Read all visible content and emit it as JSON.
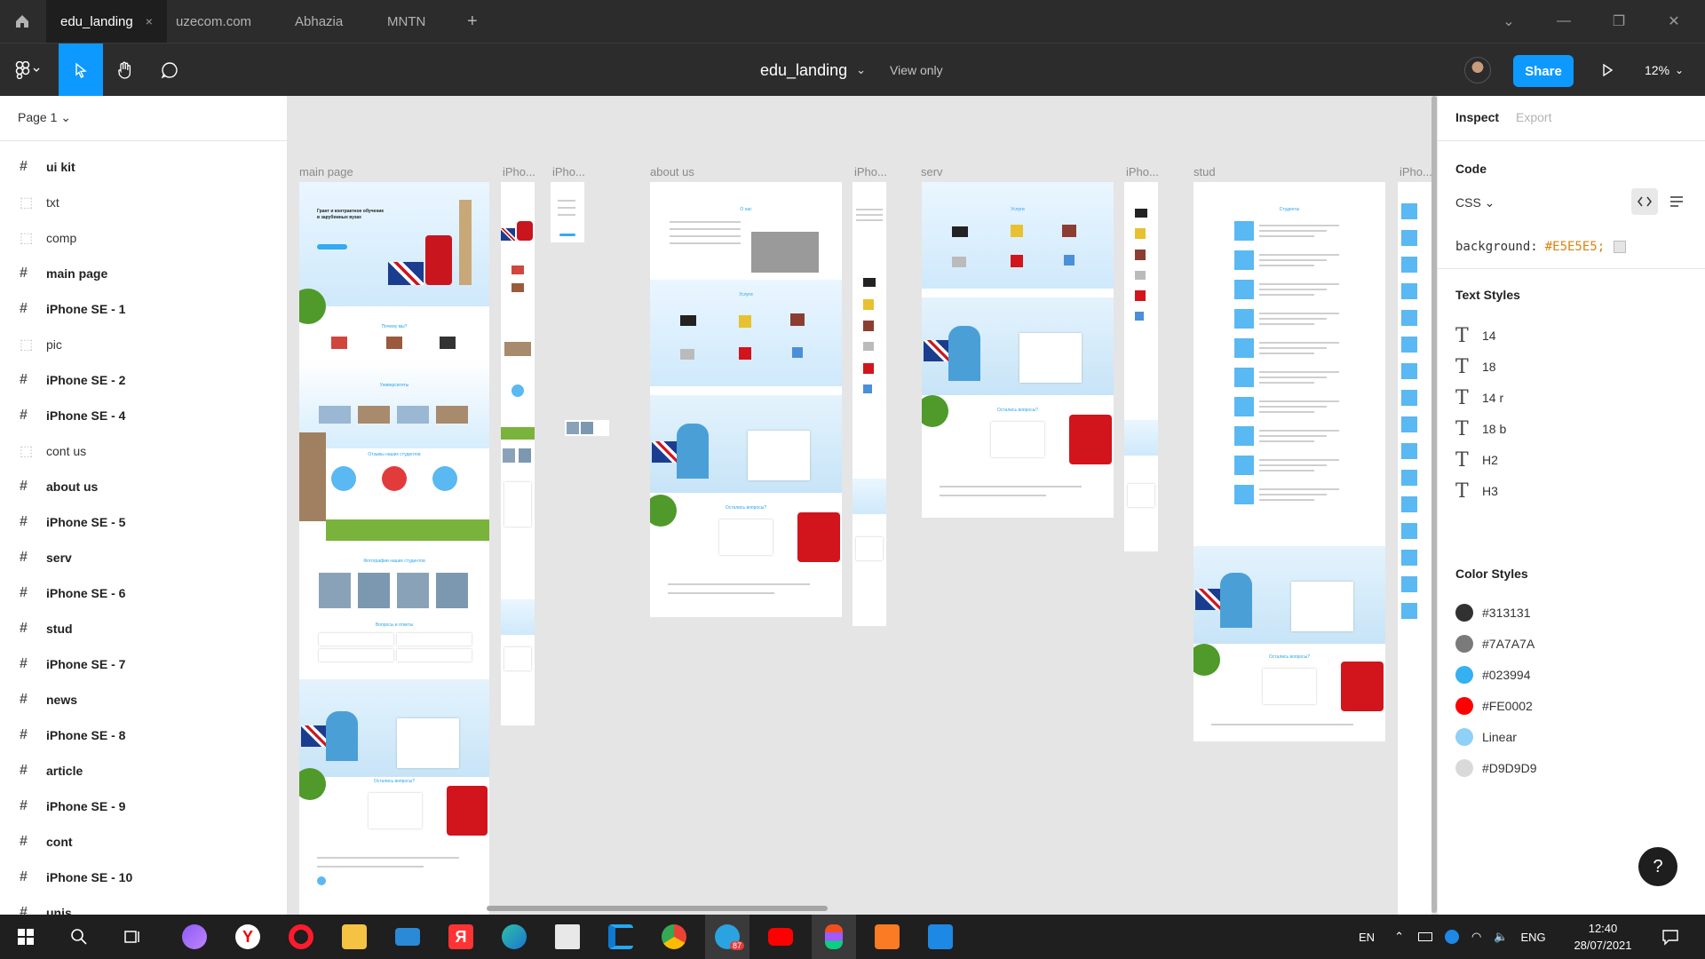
{
  "tabs": [
    {
      "label": "edu_landing",
      "close": "×"
    },
    {
      "label": "uzecom.com"
    },
    {
      "label": "Abhazia"
    },
    {
      "label": "MNTN"
    }
  ],
  "add_tab": "+",
  "window_controls": {
    "dropdown": "⌄",
    "minimize": "—",
    "restore": "❐",
    "close": "✕"
  },
  "toolbar": {
    "doc_title": "edu_landing",
    "doc_caret": "⌄",
    "view_mode": "View only",
    "share_label": "Share",
    "zoom": "12%",
    "zoom_caret": "⌄"
  },
  "left_panel": {
    "page_selector": "Page 1 ⌄",
    "layers": [
      {
        "label": "ui kit",
        "kind": "frame"
      },
      {
        "label": "txt",
        "kind": "group"
      },
      {
        "label": "comp",
        "kind": "group"
      },
      {
        "label": "main page",
        "kind": "frame"
      },
      {
        "label": "iPhone SE - 1",
        "kind": "frame"
      },
      {
        "label": "pic",
        "kind": "group"
      },
      {
        "label": "iPhone SE - 2",
        "kind": "frame"
      },
      {
        "label": "iPhone SE - 4",
        "kind": "frame"
      },
      {
        "label": "cont us",
        "kind": "group"
      },
      {
        "label": "about us",
        "kind": "frame"
      },
      {
        "label": "iPhone SE - 5",
        "kind": "frame"
      },
      {
        "label": "serv",
        "kind": "frame"
      },
      {
        "label": "iPhone SE - 6",
        "kind": "frame"
      },
      {
        "label": "stud",
        "kind": "frame"
      },
      {
        "label": "iPhone SE - 7",
        "kind": "frame"
      },
      {
        "label": "news",
        "kind": "frame"
      },
      {
        "label": "iPhone SE - 8",
        "kind": "frame"
      },
      {
        "label": "article",
        "kind": "frame"
      },
      {
        "label": "iPhone SE - 9",
        "kind": "frame"
      },
      {
        "label": "cont",
        "kind": "frame"
      },
      {
        "label": "iPhone SE - 10",
        "kind": "frame"
      },
      {
        "label": "unis",
        "kind": "frame"
      }
    ]
  },
  "canvas": {
    "background": "#E5E5E5",
    "frame_labels": {
      "main_page": "main page",
      "iphone_a": "iPho...",
      "iphone_b": "iPho...",
      "about_us": "about us",
      "iphone_c": "iPho...",
      "serv": "serv",
      "iphone_d": "iPho...",
      "stud": "stud",
      "iphone_e": "iPho..."
    },
    "main_page_texts": {
      "hero_title": "Грант и контрактное обучение",
      "hero_title_2": "в зарубежных вузах",
      "why_us": "Почему мы?",
      "universities": "Университеты",
      "reviews": "Отзывы наших студентов",
      "photos": "Фотографии наших студентов",
      "faq": "Вопросы и ответы",
      "questions_left": "Остались вопросы?"
    },
    "about_texts": {
      "title": "О нас",
      "services": "Услуги",
      "questions_left": "Остались вопросы?"
    },
    "serv_texts": {
      "title": "Услуги",
      "questions_left": "Остались вопросы?"
    },
    "stud_texts": {
      "title": "Студенты",
      "questions_left": "Остались вопросы?"
    }
  },
  "right_panel": {
    "tabs": {
      "inspect": "Inspect",
      "export": "Export"
    },
    "code": {
      "title": "Code",
      "language": "CSS ⌄",
      "property": "background:",
      "value": "#E5E5E5;",
      "code_icon": "code-icon",
      "list_icon": "list-icon"
    },
    "text_styles": {
      "title": "Text Styles",
      "items": [
        "14",
        "18",
        "14 r",
        "18 b",
        "H2",
        "H3"
      ]
    },
    "color_styles": {
      "title": "Color Styles",
      "items": [
        {
          "label": "#313131",
          "color": "#313131"
        },
        {
          "label": "#7A7A7A",
          "color": "#7A7A7A"
        },
        {
          "label": "#023994",
          "color": "#35B0F0"
        },
        {
          "label": "#FE0002",
          "color": "#FE0002"
        },
        {
          "label": "Linear",
          "color": "#8FD0F7"
        },
        {
          "label": "#D9D9D9",
          "color": "#D9D9D9"
        }
      ]
    },
    "help": "?"
  },
  "taskbar": {
    "tray": {
      "lang_short": "EN",
      "lang": "ENG"
    },
    "time": "12:40",
    "date": "28/07/2021",
    "telegram_badge": "87"
  }
}
